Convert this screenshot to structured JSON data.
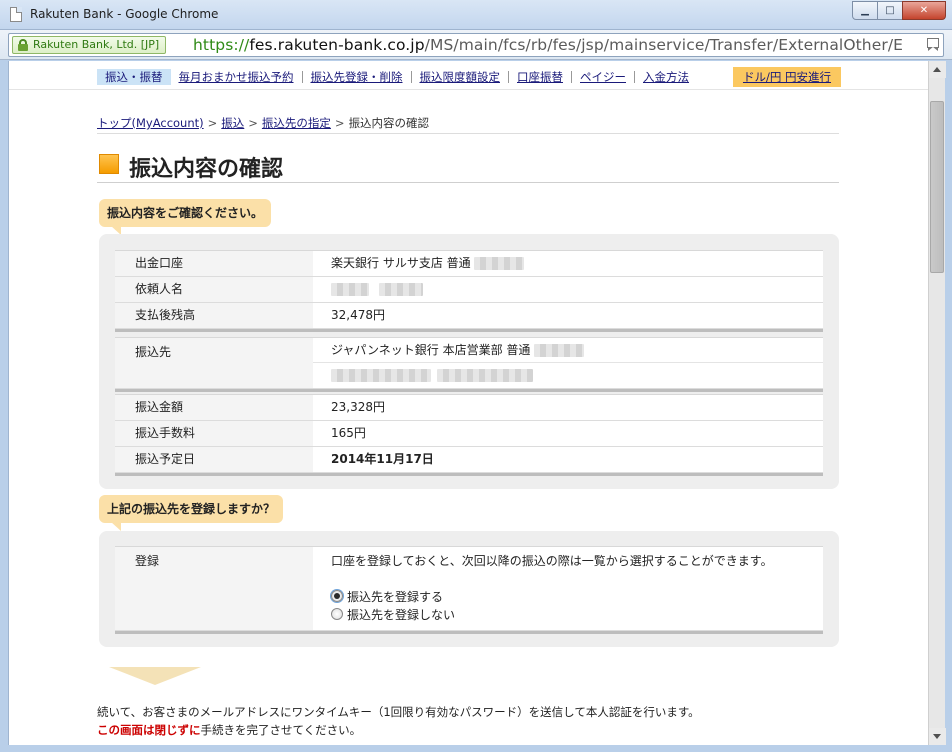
{
  "window": {
    "title": "Rakuten Bank - Google Chrome",
    "btn_min": "▁",
    "btn_max": "□",
    "btn_close": "✕"
  },
  "address_bar": {
    "ev_label": "Rakuten Bank, Ltd. [JP]",
    "scheme": "https://",
    "host": "fes.rakuten-bank.co.jp",
    "path": "/MS/main/fcs/rb/fes/jsp/mainservice/Transfer/ExternalOther/E"
  },
  "nav": {
    "items": [
      "振込・振替",
      "毎月おまかせ振込予約",
      "振込先登録・削除",
      "振込限度額設定",
      "口座振替",
      "ペイジー",
      "入金方法"
    ],
    "promo": "ドル/円 円安進行"
  },
  "breadcrumb": {
    "top": "トップ(MyAccount)",
    "transfer": "振込",
    "dest": "振込先の指定",
    "current": "振込内容の確認",
    "sep": ">"
  },
  "page_title": "振込内容の確認",
  "section1": {
    "callout": "振込内容をご確認ください。",
    "rows_a": [
      {
        "label": "出金口座",
        "value": "楽天銀行 サルサ支店 普通"
      },
      {
        "label": "依頼人名",
        "value": ""
      },
      {
        "label": "支払後残高",
        "value": "32,478円"
      }
    ],
    "dest_label": "振込先",
    "dest_value": "ジャパンネット銀行 本店営業部 普通",
    "rows_c": [
      {
        "label": "振込金額",
        "value": "23,328円"
      },
      {
        "label": "振込手数料",
        "value": "165円"
      },
      {
        "label": "振込予定日",
        "value": "2014年11月17日"
      }
    ]
  },
  "section2": {
    "callout": "上記の振込先を登録しますか？",
    "label": "登録",
    "description": "口座を登録しておくと、次回以降の振込の際は一覧から選択することができます。",
    "opt_register": "振込先を登録する",
    "opt_no_register": "振込先を登録しない"
  },
  "notes": {
    "line1": "続いて、お客さまのメールアドレスにワンタイムキー（1回限り有効なパスワード）を送信して本人認証を行います。",
    "warn": "この画面は閉じずに",
    "line2_rest": "手続きを完了させてください。"
  },
  "colors": {
    "accent": "#f59c00",
    "callout_bg": "#fbe0a8",
    "warn": "#cc0000",
    "ev_green": "#2f7a12"
  }
}
